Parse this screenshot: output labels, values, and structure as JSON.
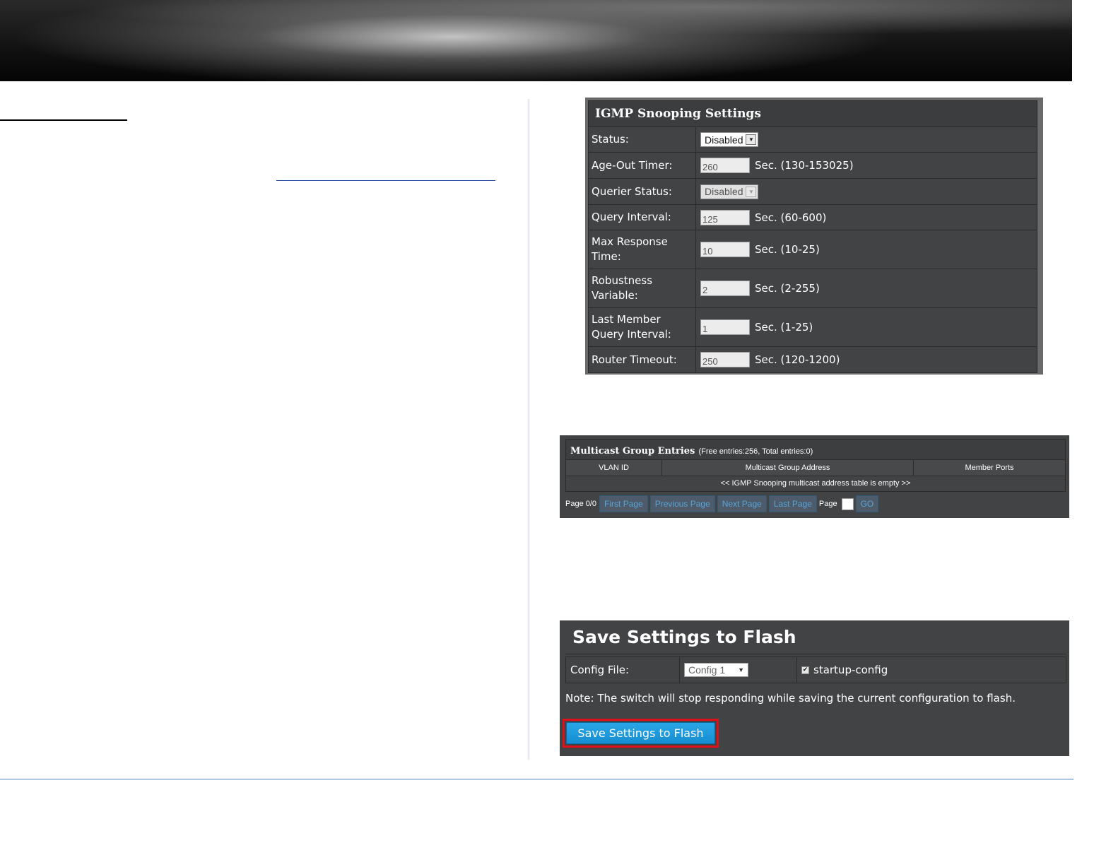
{
  "igmp": {
    "title": "IGMP Snooping Settings",
    "rows": [
      {
        "label": "Status:",
        "type": "select",
        "value": "Disabled"
      },
      {
        "label": "Age-Out Timer:",
        "type": "input",
        "value": "260",
        "unit": "Sec. (130-153025)"
      },
      {
        "label": "Querier Status:",
        "type": "select-disabled",
        "value": "Disabled"
      },
      {
        "label": "Query Interval:",
        "type": "input",
        "value": "125",
        "unit": "Sec. (60-600)"
      },
      {
        "label": "Max Response Time:",
        "type": "input",
        "value": "10",
        "unit": "Sec. (10-25)"
      },
      {
        "label": "Robustness Variable:",
        "type": "input",
        "value": "2",
        "unit": "Sec. (2-255)"
      },
      {
        "label": "Last Member Query Interval:",
        "type": "input",
        "value": "1",
        "unit": "Sec. (1-25)"
      },
      {
        "label": "Router Timeout:",
        "type": "input",
        "value": "250",
        "unit": "Sec. (120-1200)"
      }
    ]
  },
  "multicast": {
    "title": "Multicast Group Entries",
    "subtitle": "(Free entries:256, Total entries:0)",
    "columns": [
      "VLAN ID",
      "Multicast Group Address",
      "Member Ports"
    ],
    "empty_message": "<< IGMP Snooping multicast address table is empty >>",
    "pager": {
      "page_label": "Page 0/0",
      "first": "First Page",
      "previous": "Previous Page",
      "next": "Next Page",
      "last": "Last Page",
      "goto_label": "Page",
      "go": "GO"
    }
  },
  "save_flash": {
    "title": "Save Settings to Flash",
    "config_label": "Config File:",
    "config_value": "Config 1",
    "startup_label": "startup-config",
    "startup_checked": true,
    "note": "Note: The switch will stop responding while saving the current configuration to flash.",
    "button": "Save Settings to Flash"
  },
  "icons": {
    "dropdown": "chevron-down-icon",
    "checkbox": "check-icon"
  },
  "colors": {
    "panel_bg": "#424345",
    "button_blue": "#1a9ad9",
    "highlight_red": "#e0101a",
    "pager_text": "#5aa4d6"
  }
}
